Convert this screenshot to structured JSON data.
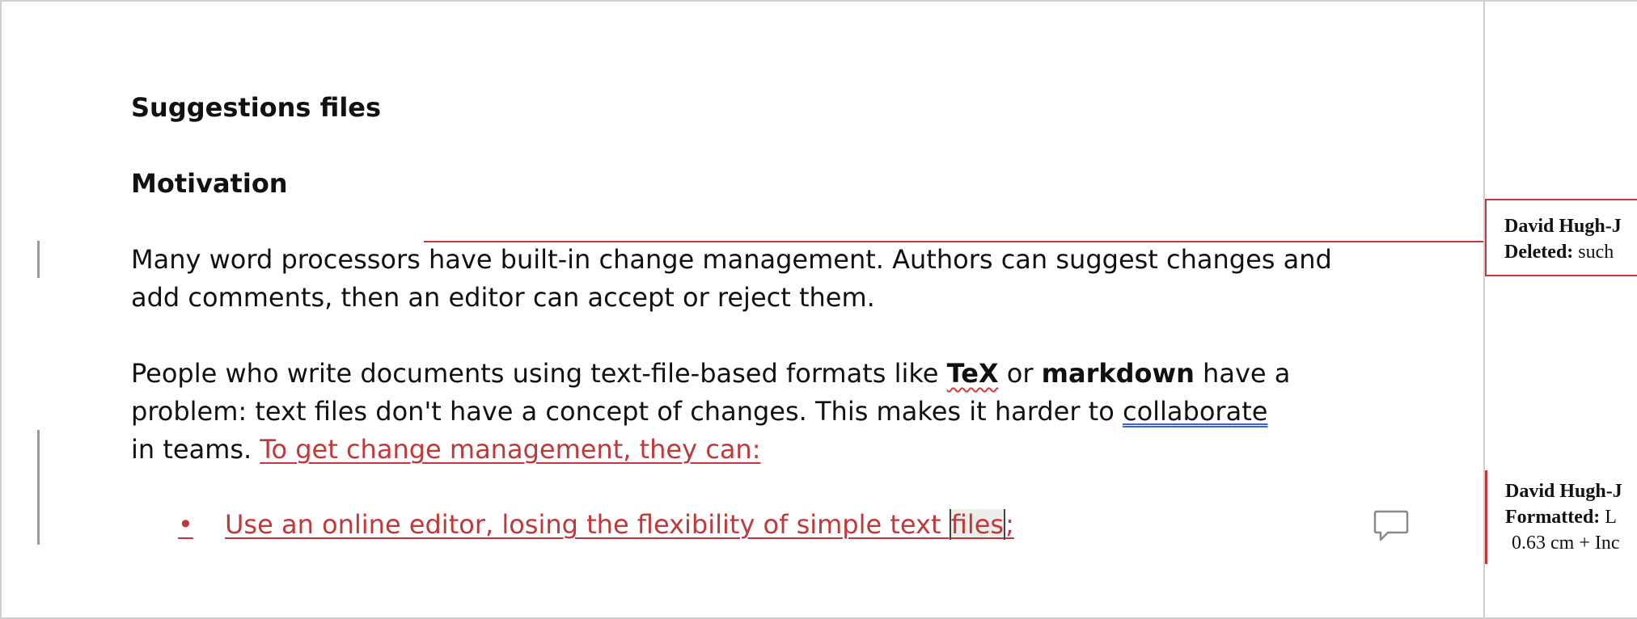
{
  "document": {
    "title": "Suggestions files",
    "section_heading": "Motivation",
    "para1": {
      "line1": "Many word processors have built-in change management. Authors can suggest changes and",
      "line2": "add comments, then an editor can accept or reject them."
    },
    "para2": {
      "l1_a": "People who write documents using text-file-based formats like ",
      "l1_tex": "TeX",
      "l1_or": " or ",
      "l1_markdown": "markdown",
      "l1_b": " have a",
      "l2_a": "problem: text files don't have a concept of changes. This makes it harder to ",
      "l2_collab": "collaborate",
      "l3_a": "in teams. ",
      "l3_inserted": "To get change management, they can:"
    },
    "bullet": {
      "marker": "•",
      "text_before": "Use an online editor, losing the flexibility of simple text ",
      "text_cursor": "files",
      "text_after": ";"
    }
  },
  "margin": {
    "balloon1": {
      "author": "David Hugh-J",
      "label": "Deleted:",
      "value": " such"
    },
    "balloon2": {
      "author": "David Hugh-J",
      "label": "Formatted:",
      "value": " L",
      "line3": "0.63 cm + Inc"
    }
  },
  "icons": {
    "comment": "comment-icon"
  },
  "colors": {
    "tracked_change": "#c0383a",
    "grammar_underline": "#3a63d6",
    "spelling_underline": "#d33b3b",
    "change_bar": "#9a9a9a"
  }
}
